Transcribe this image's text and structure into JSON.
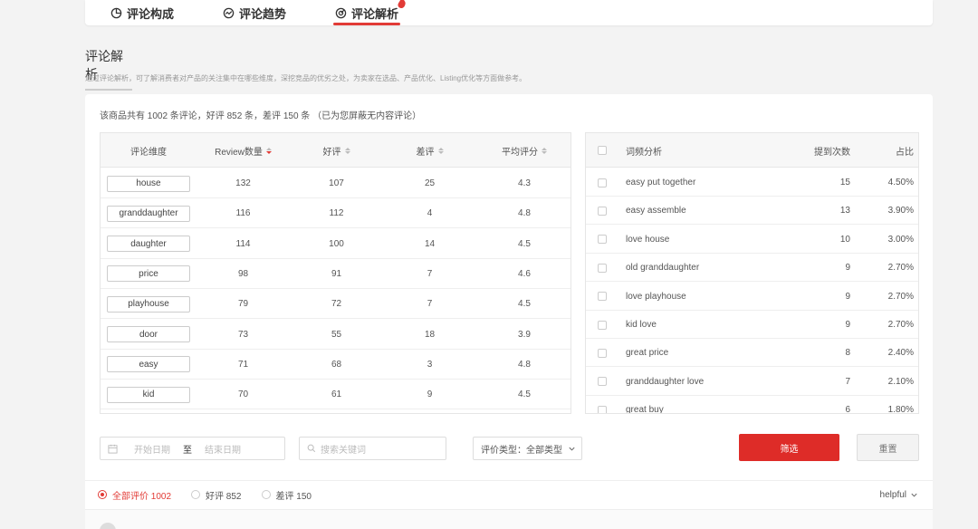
{
  "tabs": [
    {
      "label": "评论构成",
      "icon": "pie-chart-icon"
    },
    {
      "label": "评论趋势",
      "icon": "trend-icon"
    },
    {
      "label": "评论解析",
      "icon": "analysis-icon",
      "active": true
    }
  ],
  "section": {
    "title": "评论解析",
    "description": "通过评论解析，可了解消费者对产品的关注集中在哪些维度，深挖竞品的优劣之处，为卖家在选品、产品优化、Listing优化等方面做参考。"
  },
  "summary": "该商品共有 1002 条评论，好评 852 条，差评 150 条 （已为您屏蔽无内容评论）",
  "dimension_table": {
    "headers": [
      "评论维度",
      "Review数量",
      "好评",
      "差评",
      "平均评分"
    ],
    "rows": [
      {
        "dim": "house",
        "count": "132",
        "good": "107",
        "bad": "25",
        "avg": "4.3"
      },
      {
        "dim": "granddaughter",
        "count": "116",
        "good": "112",
        "bad": "4",
        "avg": "4.8"
      },
      {
        "dim": "daughter",
        "count": "114",
        "good": "100",
        "bad": "14",
        "avg": "4.5"
      },
      {
        "dim": "price",
        "count": "98",
        "good": "91",
        "bad": "7",
        "avg": "4.6"
      },
      {
        "dim": "playhouse",
        "count": "79",
        "good": "72",
        "bad": "7",
        "avg": "4.5"
      },
      {
        "dim": "door",
        "count": "73",
        "good": "55",
        "bad": "18",
        "avg": "3.9"
      },
      {
        "dim": "easy",
        "count": "71",
        "good": "68",
        "bad": "3",
        "avg": "4.8"
      },
      {
        "dim": "kid",
        "count": "70",
        "good": "61",
        "bad": "9",
        "avg": "4.5"
      }
    ]
  },
  "phrase_table": {
    "headers": [
      "词频分析",
      "提到次数",
      "占比"
    ],
    "rows": [
      {
        "phrase": "easy put together",
        "times": "15",
        "pct": "4.50%"
      },
      {
        "phrase": "easy assemble",
        "times": "13",
        "pct": "3.90%"
      },
      {
        "phrase": "love house",
        "times": "10",
        "pct": "3.00%"
      },
      {
        "phrase": "old granddaughter",
        "times": "9",
        "pct": "2.70%"
      },
      {
        "phrase": "love playhouse",
        "times": "9",
        "pct": "2.70%"
      },
      {
        "phrase": "kid love",
        "times": "9",
        "pct": "2.70%"
      },
      {
        "phrase": "great price",
        "times": "8",
        "pct": "2.40%"
      },
      {
        "phrase": "granddaughter love",
        "times": "7",
        "pct": "2.10%"
      },
      {
        "phrase": "great buy",
        "times": "6",
        "pct": "1.80%"
      }
    ]
  },
  "filters": {
    "start_date_placeholder": "开始日期",
    "to": "至",
    "end_date_placeholder": "结束日期",
    "search_placeholder": "搜索关键词",
    "type_label": "评价类型：",
    "type_value": "全部类型",
    "filter_button": "筛选",
    "reset_button": "重置"
  },
  "review_types": [
    {
      "label": "全部评价 1002",
      "selected": true
    },
    {
      "label": "好评 852",
      "selected": false
    },
    {
      "label": "差评 150",
      "selected": false
    }
  ],
  "sort": {
    "label": "helpful"
  },
  "colors": {
    "accent": "#e23b36",
    "button": "#de2c28"
  }
}
